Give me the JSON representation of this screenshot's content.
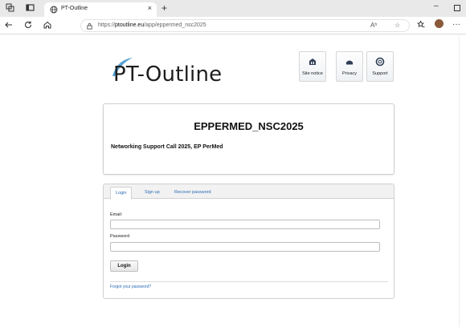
{
  "browser": {
    "tab_title": "PT-Outline",
    "tab_close": "×",
    "new_tab": "+",
    "minimize": "–",
    "url_prefix": "https://",
    "url_domain": "ptoutline.eu",
    "url_path": "/app/eppermed_nsc2025",
    "read_aloud": "Aʰ",
    "more": "···"
  },
  "site": {
    "logo_text": "PT-Outline",
    "top_buttons": [
      {
        "label": "Site notice",
        "icon": "building-icon"
      },
      {
        "label": "Privacy",
        "icon": "privacy-icon"
      },
      {
        "label": "Support",
        "icon": "support-icon"
      }
    ]
  },
  "call": {
    "title": "EPPERMED_NSC2025",
    "subtitle": "Networking Support Call 2025, EP PerMed"
  },
  "login": {
    "tabs": [
      "Login",
      "Sign up",
      "Recover password"
    ],
    "active_tab": "Login",
    "email_label": "Email:",
    "email_value": "",
    "password_label": "Password",
    "password_value": "",
    "submit_label": "Login",
    "forgot_link": "Forgot your password?"
  },
  "colors": {
    "link": "#2a6bb5",
    "logo_accent": "#3a8fc9"
  }
}
